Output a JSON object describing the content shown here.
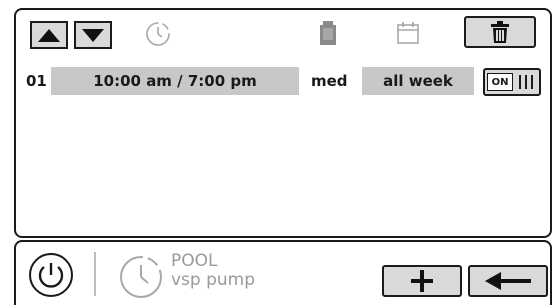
{
  "toolbar": {
    "up_icon": "triangle-up-icon",
    "down_icon": "triangle-down-icon",
    "clock_icon": "clock-icon",
    "pump_icon": "pump-icon",
    "calendar_icon": "calendar-icon",
    "trash_icon": "trash-icon"
  },
  "schedule": {
    "rows": [
      {
        "number": "01",
        "time": "10:00 am / 7:00 pm",
        "speed": "med",
        "days": "all week",
        "toggle_label": "ON"
      }
    ]
  },
  "bottom": {
    "power_icon": "power-icon",
    "device_line1": "POOL",
    "device_line2": "vsp pump",
    "add_icon": "plus-icon",
    "back_icon": "arrow-left-icon"
  },
  "colors": {
    "border": "#1a1a1a",
    "button_fill": "#d9d9d9",
    "cell_fill": "#c8c8c8",
    "muted_icon": "#a8a8a8"
  }
}
